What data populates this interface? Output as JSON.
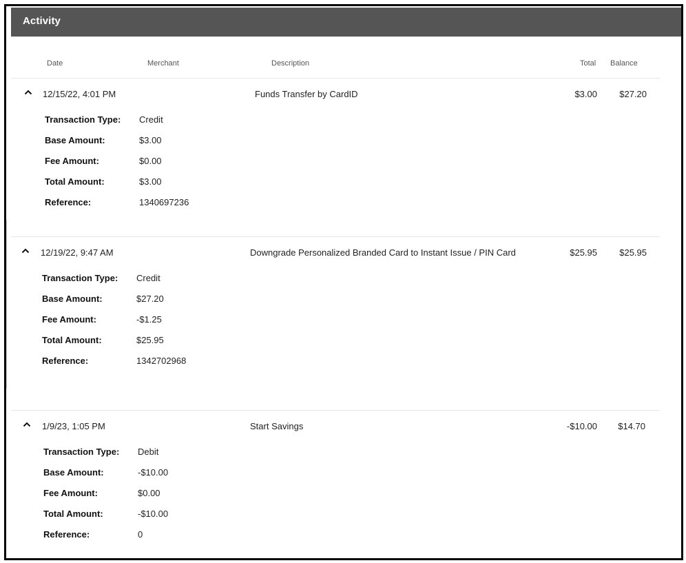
{
  "panel": {
    "title": "Activity"
  },
  "columns": {
    "date": "Date",
    "merchant": "Merchant",
    "description": "Description",
    "total": "Total",
    "balance": "Balance"
  },
  "detail_labels": {
    "type": "Transaction Type:",
    "base": "Base Amount:",
    "fee": "Fee Amount:",
    "total": "Total Amount:",
    "reference": "Reference:"
  },
  "transactions": [
    {
      "date": "12/15/22, 4:01 PM",
      "merchant": "",
      "description": "Funds Transfer by CardID",
      "total": "$3.00",
      "balance": "$27.20",
      "type": "Credit",
      "base_amount": "$3.00",
      "fee_amount": "$0.00",
      "total_amount": "$3.00",
      "reference": "1340697236"
    },
    {
      "date": "12/19/22, 9:47 AM",
      "merchant": "",
      "description": "Downgrade Personalized Branded Card to Instant Issue / PIN Card",
      "total": "$25.95",
      "balance": "$25.95",
      "type": "Credit",
      "base_amount": "$27.20",
      "fee_amount": "-$1.25",
      "total_amount": "$25.95",
      "reference": "1342702968"
    },
    {
      "date": "1/9/23, 1:05 PM",
      "merchant": "",
      "description": "Start Savings",
      "total": "-$10.00",
      "balance": "$14.70",
      "type": "Debit",
      "base_amount": "-$10.00",
      "fee_amount": "$0.00",
      "total_amount": "-$10.00",
      "reference": "0"
    }
  ],
  "icons": {
    "expand": "chevron-up-icon"
  },
  "colors": {
    "header_bg": "#555555",
    "header_text": "#ffffff",
    "border": "#000000",
    "divider": "#e6e6e6"
  }
}
